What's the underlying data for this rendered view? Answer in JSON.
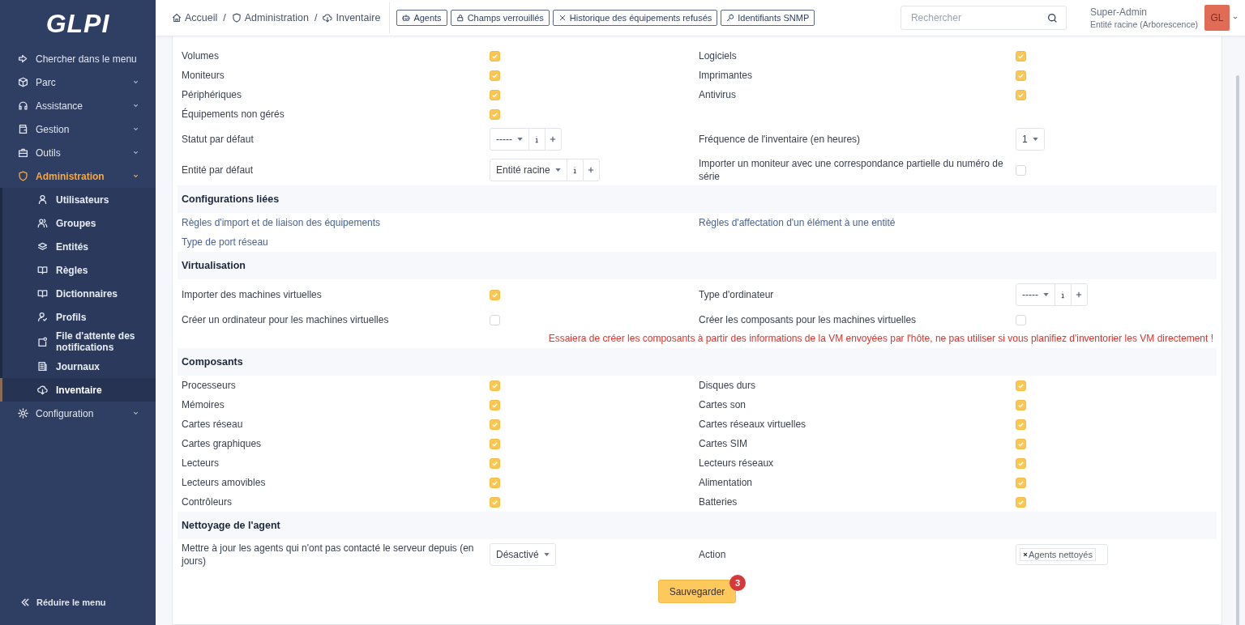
{
  "sidebar": {
    "logo": "GLPI",
    "search_label": "Chercher dans le menu",
    "items": [
      {
        "label": "Parc",
        "selected": false,
        "expanded": false
      },
      {
        "label": "Assistance",
        "selected": false,
        "expanded": false
      },
      {
        "label": "Gestion",
        "selected": false,
        "expanded": false
      },
      {
        "label": "Outils",
        "selected": false,
        "expanded": false
      },
      {
        "label": "Administration",
        "selected": true,
        "expanded": true,
        "children": [
          {
            "label": "Utilisateurs",
            "selected": false
          },
          {
            "label": "Groupes",
            "selected": false
          },
          {
            "label": "Entités",
            "selected": false
          },
          {
            "label": "Règles",
            "selected": false
          },
          {
            "label": "Dictionnaires",
            "selected": false
          },
          {
            "label": "Profils",
            "selected": false
          },
          {
            "label": "File d'attente des notifications",
            "selected": false
          },
          {
            "label": "Journaux",
            "selected": false
          },
          {
            "label": "Inventaire",
            "selected": true
          }
        ]
      },
      {
        "label": "Configuration",
        "selected": false,
        "expanded": false
      }
    ],
    "collapse_label": "Réduire le menu"
  },
  "topbar": {
    "breadcrumbs": [
      "Accueil",
      "Administration",
      "Inventaire"
    ],
    "breadcrumb_separator": "/",
    "actions": [
      "Agents",
      "Champs verrouillés",
      "Historique des équipements refusés",
      "Identifiants SNMP"
    ],
    "search": {
      "placeholder": "Rechercher"
    },
    "user": {
      "name": "Super-Admin",
      "entity": "Entité racine (Arborescence)",
      "initials": "GL"
    }
  },
  "sections": [
    {
      "rows": [
        {
          "kind": "fields",
          "cells": [
            {
              "kind": "check",
              "label": "Volumes",
              "checked": true
            },
            {
              "kind": "check",
              "label": "Logiciels",
              "checked": true
            }
          ]
        },
        {
          "kind": "fields",
          "cells": [
            {
              "kind": "check",
              "label": "Moniteurs",
              "checked": true
            },
            {
              "kind": "check",
              "label": "Imprimantes",
              "checked": true
            }
          ]
        },
        {
          "kind": "fields",
          "cells": [
            {
              "kind": "check",
              "label": "Périphériques",
              "checked": true
            },
            {
              "kind": "check",
              "label": "Antivirus",
              "checked": true
            }
          ]
        },
        {
          "kind": "fields",
          "cells": [
            {
              "kind": "check",
              "label": "Équipements non gérés",
              "checked": true
            }
          ]
        },
        {
          "kind": "fields",
          "cells": [
            {
              "kind": "select",
              "label": "Statut par défaut",
              "value": "-----",
              "info": true,
              "add": true
            },
            {
              "kind": "select",
              "label": "Fréquence de l'inventaire (en heures)",
              "value": "1",
              "info": false,
              "add": false
            }
          ]
        },
        {
          "kind": "fields",
          "cells": [
            {
              "kind": "select",
              "label": "Entité par défaut",
              "value": "Entité racine",
              "info": true,
              "add": true
            },
            {
              "kind": "check",
              "label": "Importer un moniteur avec une correspondance partielle du numéro de série",
              "checked": false
            }
          ]
        }
      ]
    },
    {
      "title": "Configurations liées",
      "rows": [
        {
          "kind": "fields",
          "cells": [
            {
              "kind": "link",
              "label": "Règles d'import et de liaison des équipements"
            },
            {
              "kind": "link",
              "label": "Règles d'affectation d'un élément à une entité"
            }
          ]
        },
        {
          "kind": "fields",
          "cells": [
            {
              "kind": "link",
              "label": "Type de port réseau"
            }
          ]
        }
      ]
    },
    {
      "title": "Virtualisation",
      "rows": [
        {
          "kind": "fields",
          "cells": [
            {
              "kind": "check",
              "label": "Importer des machines virtuelles",
              "checked": true
            },
            {
              "kind": "select",
              "label": "Type d'ordinateur",
              "value": "-----",
              "info": true,
              "add": true
            }
          ]
        },
        {
          "kind": "fields",
          "cells": [
            {
              "kind": "check",
              "label": "Créer un ordinateur pour les machines virtuelles",
              "checked": false
            },
            {
              "kind": "check",
              "label": "Créer les composants pour les machines virtuelles",
              "checked": false
            }
          ]
        },
        {
          "kind": "note",
          "text": "Essaiera de créer les composants à partir des informations de la VM envoyées par l'hôte, ne pas utiliser si vous planifiez d'inventorier les VM directement !"
        }
      ]
    },
    {
      "title": "Composants",
      "rows": [
        {
          "kind": "fields",
          "cells": [
            {
              "kind": "check",
              "label": "Processeurs",
              "checked": true
            },
            {
              "kind": "check",
              "label": "Disques durs",
              "checked": true
            }
          ]
        },
        {
          "kind": "fields",
          "cells": [
            {
              "kind": "check",
              "label": "Mémoires",
              "checked": true
            },
            {
              "kind": "check",
              "label": "Cartes son",
              "checked": true
            }
          ]
        },
        {
          "kind": "fields",
          "cells": [
            {
              "kind": "check",
              "label": "Cartes réseau",
              "checked": true
            },
            {
              "kind": "check",
              "label": "Cartes réseaux virtuelles",
              "checked": true
            }
          ]
        },
        {
          "kind": "fields",
          "cells": [
            {
              "kind": "check",
              "label": "Cartes graphiques",
              "checked": true
            },
            {
              "kind": "check",
              "label": "Cartes SIM",
              "checked": true
            }
          ]
        },
        {
          "kind": "fields",
          "cells": [
            {
              "kind": "check",
              "label": "Lecteurs",
              "checked": true
            },
            {
              "kind": "check",
              "label": "Lecteurs réseaux",
              "checked": true
            }
          ]
        },
        {
          "kind": "fields",
          "cells": [
            {
              "kind": "check",
              "label": "Lecteurs amovibles",
              "checked": true
            },
            {
              "kind": "check",
              "label": "Alimentation",
              "checked": true
            }
          ]
        },
        {
          "kind": "fields",
          "cells": [
            {
              "kind": "check",
              "label": "Contrôleurs",
              "checked": true
            },
            {
              "kind": "check",
              "label": "Batteries",
              "checked": true
            }
          ]
        }
      ]
    },
    {
      "title": "Nettoyage de l'agent",
      "rows": [
        {
          "kind": "fields",
          "cells": [
            {
              "kind": "select",
              "label": "Mettre à jour les agents qui n'ont pas contacté le serveur depuis (en jours)",
              "value": "Désactivé",
              "info": false,
              "add": false
            },
            {
              "kind": "tags",
              "label": "Action",
              "tags": [
                "Agents nettoyés"
              ]
            }
          ]
        }
      ]
    }
  ],
  "save": {
    "label": "Sauvegarder",
    "badge": "3"
  }
}
